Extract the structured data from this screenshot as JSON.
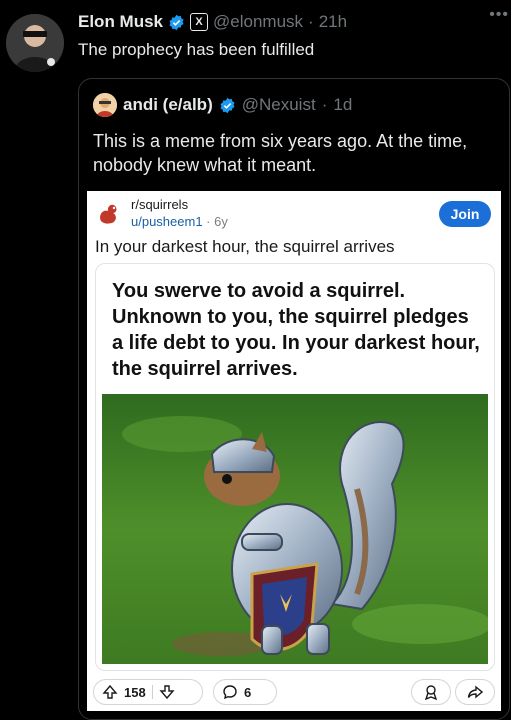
{
  "tweet": {
    "author_name": "Elon Musk",
    "handle": "@elonmusk",
    "dot": "·",
    "time": "21h",
    "text": "The prophecy has been fulfilled",
    "more_icon": "more-icon",
    "x_badge": "X"
  },
  "quote": {
    "author_name": "andi (e/alb)",
    "handle": "@Nexuist",
    "dot": "·",
    "time": "1d",
    "text": "This is a meme from six years ago. At the time, nobody knew what it meant."
  },
  "reddit": {
    "subreddit": "r/squirrels",
    "user": "u/pusheem1",
    "age": " · 6y",
    "join_label": "Join",
    "title": "In your darkest hour, the squirrel arrives",
    "meme_text": "You swerve to avoid a squirrel. Unknown to you, the squirrel pledges a life debt to you. In your darkest hour, the squirrel arrives.",
    "upvotes": "158",
    "comments": "6"
  },
  "colors": {
    "background": "#000000",
    "text": "#e7e9ea",
    "muted": "#71767b",
    "verified_blue": "#1d9bf0",
    "reddit_blue": "#1d6fd8"
  }
}
